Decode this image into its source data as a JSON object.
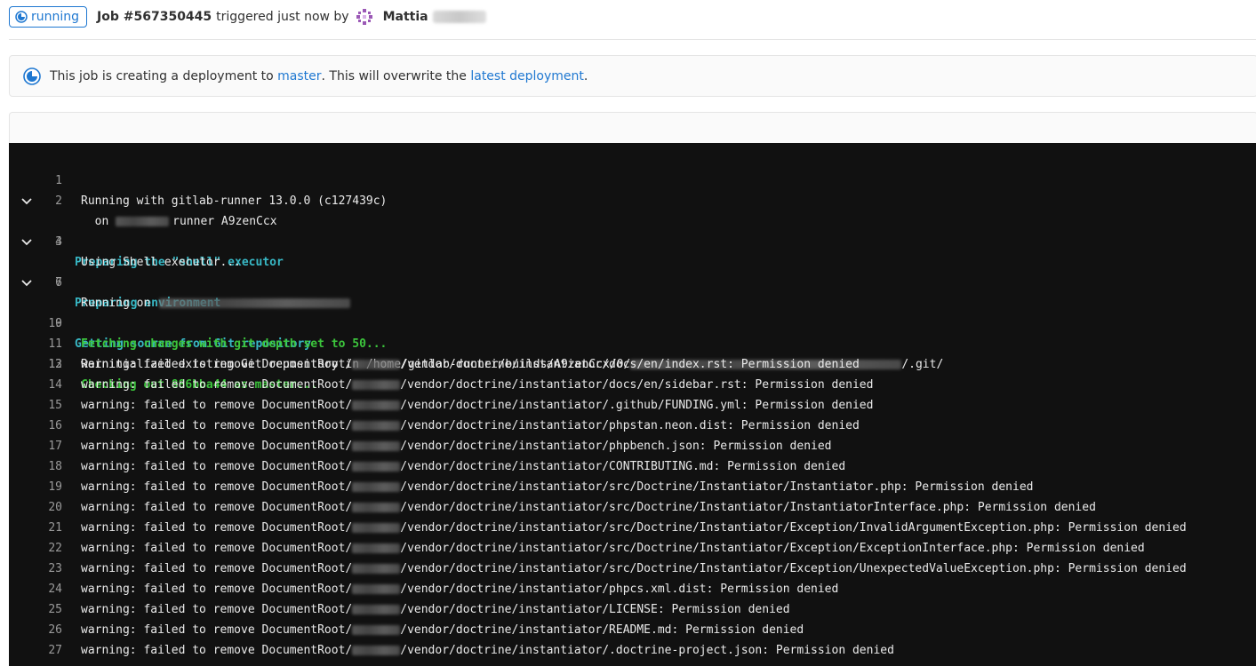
{
  "header": {
    "status": "running",
    "job": "Job #567350445",
    "triggered": "triggered just now by",
    "user": "Mattia"
  },
  "alert": {
    "prefix": "This job is creating a deployment to ",
    "env_link": "master",
    "middle": ". This will overwrite the ",
    "deploy_link": "latest deployment",
    "suffix": "."
  },
  "colors": {
    "link": "#1f78d1",
    "section": "#38b8c5",
    "success": "#3cc53c",
    "log_bg": "#111111"
  },
  "log": {
    "l1": "Running with gitlab-runner 13.0.0 (c127439c)",
    "l2_pre": "  on ",
    "l2_post": "runner A9zenCcx",
    "l3": "Preparing the \"shell\" executor",
    "l4": "Using Shell executor...",
    "l6": "Preparing environment",
    "l7": "Running on",
    "l9": "Getting source from Git repository",
    "l10": "Fetching changes with git depth set to 50...",
    "l11_pre": "Reinitialized existing Git repository in /home/gitlab-runner/builds/A9zenCcx/0/",
    "l11_post": "/.git/",
    "l12": "Checking out 886bba44 as master...",
    "warn_prefix": "warning: failed to remove DocumentRoot/",
    "warnings": [
      "/vendor/doctrine/instantiator/docs/en/index.rst: Permission denied",
      "/vendor/doctrine/instantiator/docs/en/sidebar.rst: Permission denied",
      "/vendor/doctrine/instantiator/.github/FUNDING.yml: Permission denied",
      "/vendor/doctrine/instantiator/phpstan.neon.dist: Permission denied",
      "/vendor/doctrine/instantiator/phpbench.json: Permission denied",
      "/vendor/doctrine/instantiator/CONTRIBUTING.md: Permission denied",
      "/vendor/doctrine/instantiator/src/Doctrine/Instantiator/Instantiator.php: Permission denied",
      "/vendor/doctrine/instantiator/src/Doctrine/Instantiator/InstantiatorInterface.php: Permission denied",
      "/vendor/doctrine/instantiator/src/Doctrine/Instantiator/Exception/InvalidArgumentException.php: Permission denied",
      "/vendor/doctrine/instantiator/src/Doctrine/Instantiator/Exception/ExceptionInterface.php: Permission denied",
      "/vendor/doctrine/instantiator/src/Doctrine/Instantiator/Exception/UnexpectedValueException.php: Permission denied",
      "/vendor/doctrine/instantiator/phpcs.xml.dist: Permission denied",
      "/vendor/doctrine/instantiator/LICENSE: Permission denied",
      "/vendor/doctrine/instantiator/README.md: Permission denied",
      "/vendor/doctrine/instantiator/.doctrine-project.json: Permission denied"
    ],
    "numbers": [
      "1",
      "2",
      "3",
      "4",
      "5",
      "6",
      "7",
      "8",
      "9",
      "10",
      "11",
      "12",
      "13",
      "14",
      "15",
      "16",
      "17",
      "18",
      "19",
      "20",
      "21",
      "22",
      "23",
      "24",
      "25",
      "26",
      "27"
    ]
  }
}
